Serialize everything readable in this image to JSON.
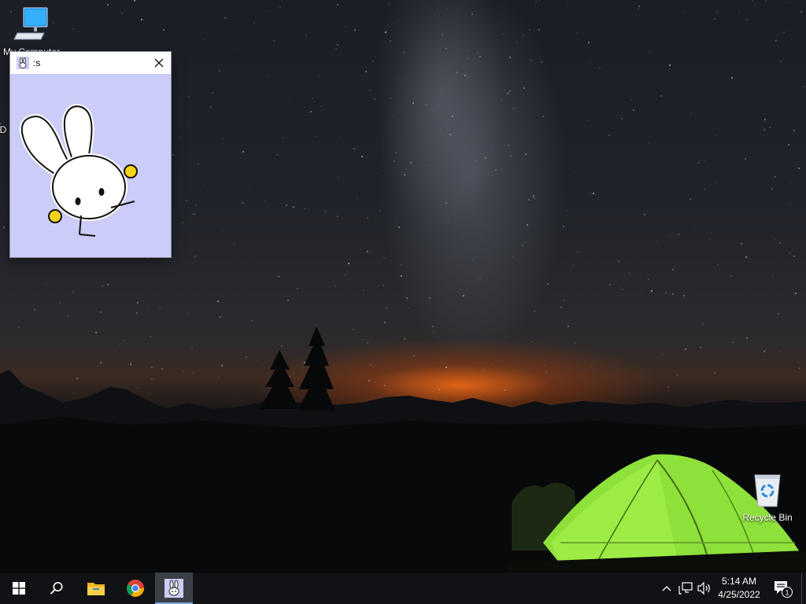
{
  "desktop": {
    "icons": [
      {
        "label": "My Computer",
        "icon": "computer-icon"
      },
      {
        "label": "Recycle Bin",
        "icon": "recycle-bin-icon"
      }
    ],
    "partial_icon_label": "D"
  },
  "window": {
    "title": ":s",
    "icon": "bunny-app-icon",
    "close_icon": "close-icon",
    "background": "#ccccf8"
  },
  "taskbar": {
    "start_icon": "windows-start-icon",
    "search_icon": "search-icon",
    "pinned": [
      {
        "name": "File Explorer",
        "icon": "folder-icon"
      },
      {
        "name": "Google Chrome",
        "icon": "chrome-icon"
      },
      {
        "name": ":s",
        "icon": "bunny-app-icon",
        "active": true
      }
    ],
    "tray": {
      "chevron_icon": "chevron-up-icon",
      "network_icon": "network-icon",
      "volume_icon": "volume-icon",
      "notification_icon": "notification-icon",
      "notification_count": "1"
    },
    "clock": {
      "time": "5:14 AM",
      "date": "4/25/2022"
    }
  }
}
